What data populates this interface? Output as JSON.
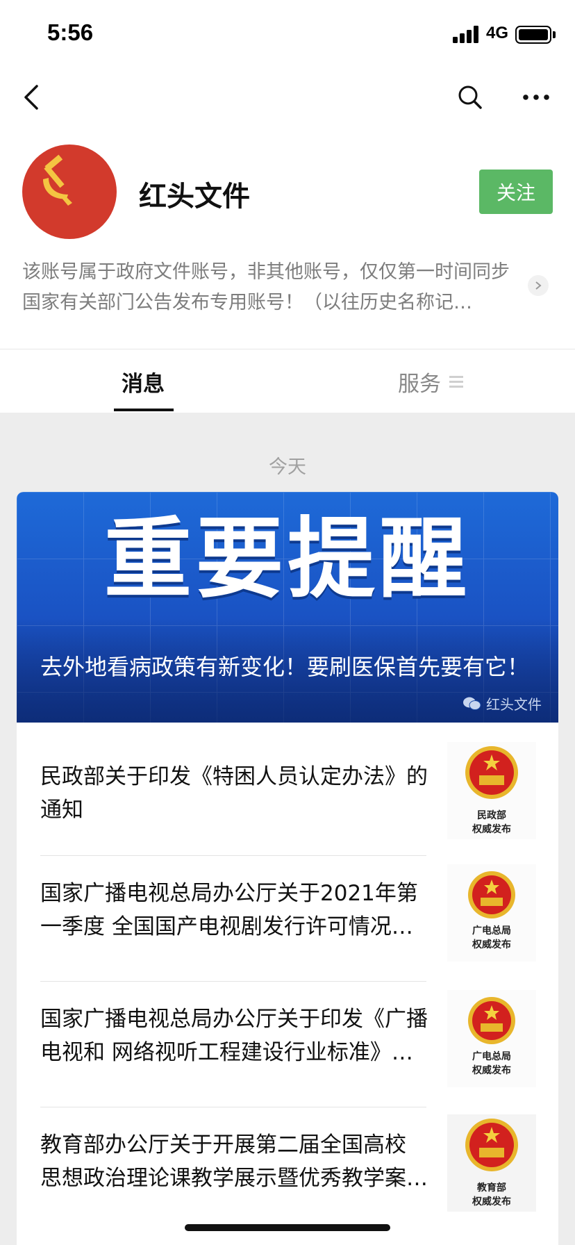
{
  "status_bar": {
    "time": "5:56",
    "network": "4G"
  },
  "nav": {
    "back_icon": "chevron-left-icon",
    "search_icon": "search-icon",
    "more_icon": "more-dots-icon"
  },
  "account": {
    "name": "红头文件",
    "follow_label": "关注",
    "description": "该账号属于政府文件账号，非其他账号，仅仅第一时间同步国家有关部门公告发布专用账号！（以往历史名称记…"
  },
  "tabs": {
    "messages": "消息",
    "services": "服务"
  },
  "feed": {
    "date_label": "今天",
    "banner": {
      "image_text": "重要提醒",
      "title": "去外地看病政策有新变化！要刷医保首先要有它！",
      "source": "红头文件"
    },
    "articles": [
      {
        "title": "民政部关于印发《特困人员认定办法》的通知",
        "thumb_line1": "民政部",
        "thumb_line2": "权威发布"
      },
      {
        "title": "国家广播电视总局办公厅关于2021年第一季度 全国国产电视剧发行许可情况的通告",
        "thumb_line1": "广电总局",
        "thumb_line2": "权威发布"
      },
      {
        "title": "国家广播电视总局办公厅关于印发《广播电视和 网络视听工程建设行业标准》的通知",
        "thumb_line1": "广电总局",
        "thumb_line2": "权威发布"
      },
      {
        "title": "教育部办公厅关于开展第二届全国高校 思想政治理论课教学展示暨优秀教学案例评选",
        "thumb_line1": "教育部",
        "thumb_line2": "权威发布"
      }
    ]
  },
  "colors": {
    "follow_green": "#5bb865",
    "banner_blue": "#1a52c3",
    "emblem_red": "#d2211e",
    "party_red": "#d23a2c"
  }
}
